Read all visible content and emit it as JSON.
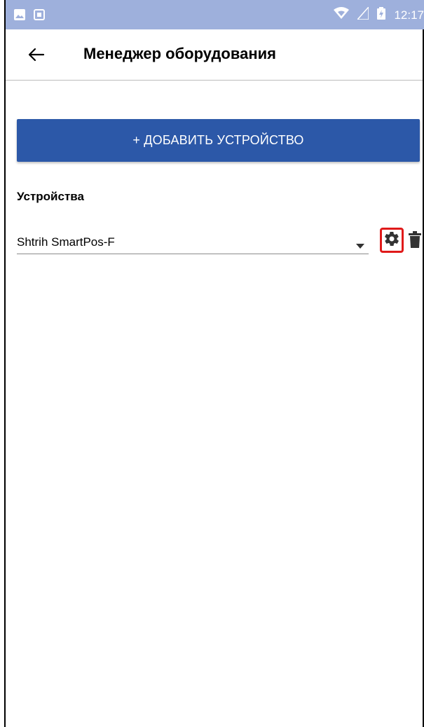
{
  "status_bar": {
    "time": "12:17",
    "left_icons": [
      "image-icon",
      "square-icon"
    ],
    "right_icons": [
      "wifi-icon",
      "signal-icon",
      "battery-icon"
    ],
    "background": "#9eb0dc"
  },
  "app_bar": {
    "title": "Менеджер оборудования",
    "back_icon": "arrow-left-icon"
  },
  "main": {
    "add_button_label": "+ ДОБАВИТЬ УСТРОЙСТВО",
    "accent": "#2c58a8",
    "devices_section_title": "Устройства",
    "device_select": {
      "value": "Shtrih SmartPos-F",
      "icon": "chevron-down-icon"
    },
    "settings_icon": "gear-icon",
    "delete_icon": "trash-icon",
    "highlight_color": "#e01a1a"
  }
}
